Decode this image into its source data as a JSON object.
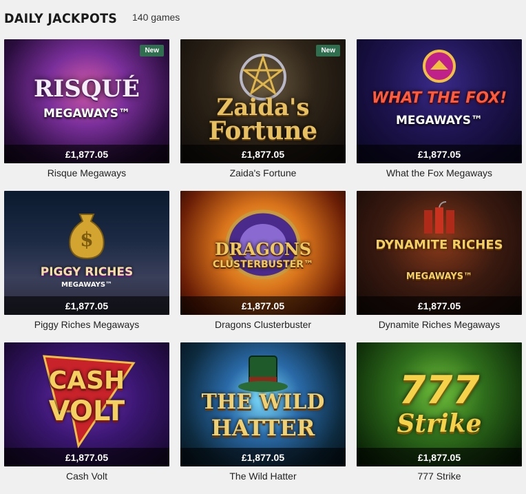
{
  "header": {
    "title": "DAILY JACKPOTS",
    "count": "140 games"
  },
  "colors": {
    "badge_new": "#2f6e4f",
    "jackpot_bar": "rgba(0,0,0,0.6)",
    "background": "#f0f0f0"
  },
  "games": [
    {
      "name": "Risque Megaways",
      "jackpot": "£1,877.05",
      "badge": "New",
      "art_line1": "RISQUÉ",
      "art_line2": "MEGAWAYS™"
    },
    {
      "name": "Zaida's Fortune",
      "jackpot": "£1,877.05",
      "badge": "New",
      "art_line1": "Zaida's",
      "art_line2": "Fortune"
    },
    {
      "name": "What the Fox Megaways",
      "jackpot": "£1,877.05",
      "badge": "",
      "art_line1": "WHAT THE FOX!",
      "art_line2": "MEGAWAYS™"
    },
    {
      "name": "Piggy Riches Megaways",
      "jackpot": "£1,877.05",
      "badge": "",
      "art_line1": "PIGGY RICHES",
      "art_line2": "MEGAWAYS™"
    },
    {
      "name": "Dragons Clusterbuster",
      "jackpot": "£1,877.05",
      "badge": "",
      "art_line1": "DRAGONS",
      "art_line2": "CLUSTERBUSTER™"
    },
    {
      "name": "Dynamite Riches Megaways",
      "jackpot": "£1,877.05",
      "badge": "",
      "art_line1": "DYNAMITE RICHES",
      "art_line2": "MEGAWAYS™"
    },
    {
      "name": "Cash Volt",
      "jackpot": "£1,877.05",
      "badge": "",
      "art_line1": "CASH",
      "art_line2": "VOLT"
    },
    {
      "name": "The Wild Hatter",
      "jackpot": "£1,877.05",
      "badge": "",
      "art_line1": "THE WILD",
      "art_line2": "HATTER"
    },
    {
      "name": "777 Strike",
      "jackpot": "£1,877.05",
      "badge": "",
      "art_line1": "777",
      "art_line2": "Strike"
    }
  ]
}
